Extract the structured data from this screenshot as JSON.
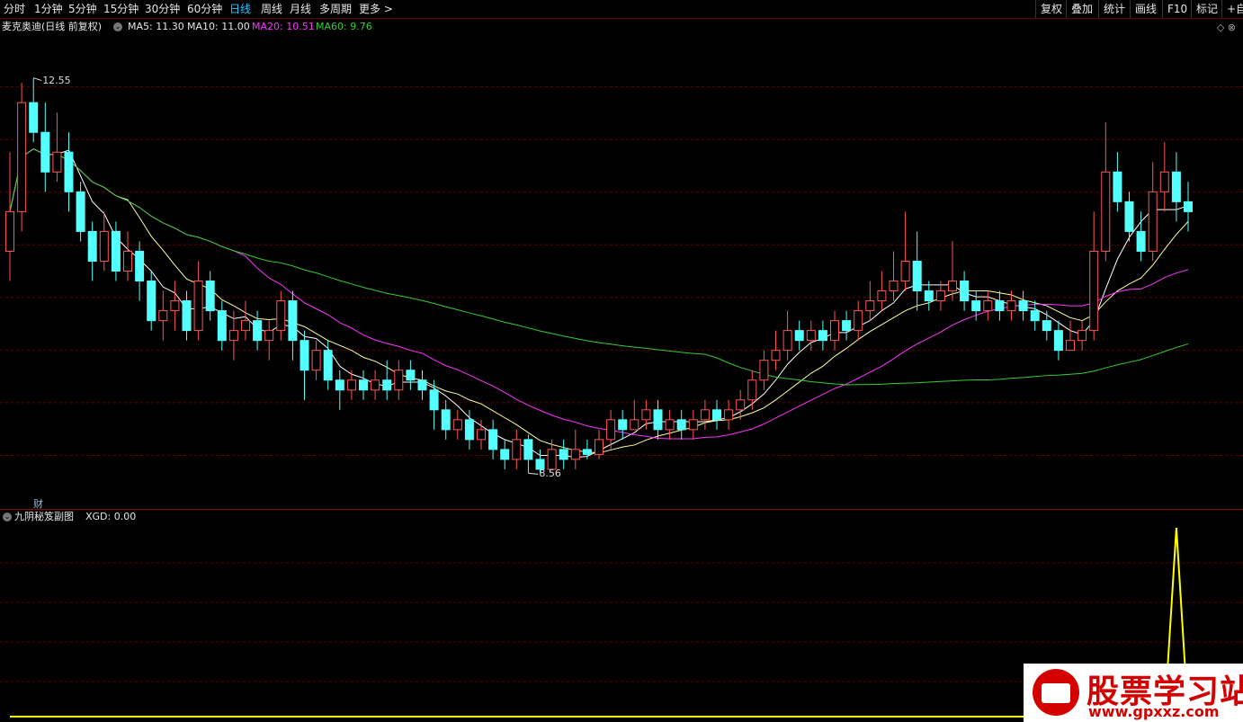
{
  "toolbar": {
    "periods": [
      "分时",
      "1分钟",
      "5分钟",
      "15分钟",
      "30分钟",
      "60分钟",
      "日线",
      "周线",
      "月线",
      "多周期",
      "更多 >"
    ],
    "active_index": 6,
    "right_buttons": [
      "复权",
      "叠加",
      "统计",
      "画线",
      "F10",
      "标记",
      "+自"
    ]
  },
  "legend": {
    "stock_label": "麦克奥迪(日线 前复权)",
    "ma5": "MA5: 11.30",
    "ma10": "MA10: 11.00",
    "ma20": "MA20: 10.51",
    "ma60": "MA60: 9.76"
  },
  "annotations": {
    "high_label": "12.55",
    "low_label": "8.56",
    "cai": "财"
  },
  "sub_indicator": {
    "name": "九阴秘笈副图",
    "xgd": "XGD: 0.00"
  },
  "watermark": {
    "title": "股票学习站",
    "url": "www.gpxxz.com"
  },
  "colors": {
    "up": "#ff5555",
    "down": "#54ffff",
    "ma5": "#ffffff",
    "ma10": "#ffff99",
    "ma20": "#ff33ff",
    "ma60": "#33cc33",
    "xgd": "#ffff00",
    "grid": "#5a0000"
  },
  "chart_data": {
    "type": "candlestick",
    "price_range": [
      8.3,
      12.9
    ],
    "candles": [
      [
        10.8,
        11.2,
        11.8,
        10.5
      ],
      [
        11.2,
        12.3,
        12.5,
        11.0
      ],
      [
        12.3,
        12.0,
        12.55,
        11.9
      ],
      [
        12.0,
        11.6,
        12.3,
        11.4
      ],
      [
        11.6,
        11.8,
        12.2,
        11.5
      ],
      [
        11.8,
        11.4,
        12.0,
        11.2
      ],
      [
        11.4,
        11.0,
        11.5,
        10.9
      ],
      [
        11.0,
        10.7,
        11.1,
        10.5
      ],
      [
        10.7,
        11.0,
        11.2,
        10.6
      ],
      [
        11.0,
        10.6,
        11.1,
        10.5
      ],
      [
        10.6,
        10.8,
        11.0,
        10.5
      ],
      [
        10.8,
        10.5,
        10.9,
        10.3
      ],
      [
        10.5,
        10.1,
        10.6,
        10.0
      ],
      [
        10.1,
        10.2,
        10.4,
        9.9
      ],
      [
        10.2,
        10.3,
        10.5,
        10.0
      ],
      [
        10.3,
        10.0,
        10.4,
        9.9
      ],
      [
        10.0,
        10.5,
        10.7,
        9.9
      ],
      [
        10.5,
        10.2,
        10.6,
        10.1
      ],
      [
        10.2,
        9.9,
        10.3,
        9.8
      ],
      [
        9.9,
        10.0,
        10.2,
        9.7
      ],
      [
        10.0,
        10.1,
        10.3,
        9.9
      ],
      [
        10.1,
        9.9,
        10.2,
        9.8
      ],
      [
        9.9,
        10.0,
        10.1,
        9.7
      ],
      [
        10.0,
        10.3,
        10.4,
        9.9
      ],
      [
        10.3,
        9.9,
        10.4,
        9.7
      ],
      [
        9.9,
        9.6,
        10.0,
        9.3
      ],
      [
        9.6,
        9.8,
        9.9,
        9.5
      ],
      [
        9.8,
        9.5,
        9.9,
        9.4
      ],
      [
        9.5,
        9.4,
        9.6,
        9.2
      ],
      [
        9.4,
        9.5,
        9.6,
        9.3
      ],
      [
        9.5,
        9.4,
        9.6,
        9.3
      ],
      [
        9.4,
        9.5,
        9.6,
        9.3
      ],
      [
        9.5,
        9.4,
        9.7,
        9.3
      ],
      [
        9.4,
        9.6,
        9.7,
        9.3
      ],
      [
        9.6,
        9.5,
        9.7,
        9.4
      ],
      [
        9.5,
        9.4,
        9.6,
        9.3
      ],
      [
        9.4,
        9.2,
        9.5,
        9.0
      ],
      [
        9.2,
        9.0,
        9.3,
        8.9
      ],
      [
        9.0,
        9.1,
        9.2,
        8.9
      ],
      [
        9.1,
        8.9,
        9.2,
        8.8
      ],
      [
        8.9,
        9.0,
        9.1,
        8.8
      ],
      [
        9.0,
        8.8,
        9.1,
        8.7
      ],
      [
        8.8,
        8.7,
        8.9,
        8.6
      ],
      [
        8.7,
        8.9,
        9.0,
        8.6
      ],
      [
        8.9,
        8.7,
        8.95,
        8.56
      ],
      [
        8.7,
        8.6,
        8.8,
        8.56
      ],
      [
        8.6,
        8.8,
        8.9,
        8.6
      ],
      [
        8.8,
        8.7,
        8.9,
        8.6
      ],
      [
        8.7,
        8.8,
        9.0,
        8.6
      ],
      [
        8.8,
        8.75,
        8.9,
        8.7
      ],
      [
        8.75,
        8.9,
        9.0,
        8.7
      ],
      [
        8.9,
        9.1,
        9.2,
        8.8
      ],
      [
        9.1,
        9.0,
        9.2,
        8.9
      ],
      [
        9.0,
        9.1,
        9.3,
        9.0
      ],
      [
        9.1,
        9.2,
        9.3,
        9.0
      ],
      [
        9.2,
        9.0,
        9.3,
        8.9
      ],
      [
        9.0,
        9.1,
        9.2,
        8.9
      ],
      [
        9.1,
        9.0,
        9.2,
        8.9
      ],
      [
        9.0,
        9.1,
        9.2,
        8.9
      ],
      [
        9.1,
        9.2,
        9.3,
        9.0
      ],
      [
        9.2,
        9.1,
        9.3,
        9.0
      ],
      [
        9.1,
        9.2,
        9.3,
        9.0
      ],
      [
        9.2,
        9.3,
        9.4,
        9.1
      ],
      [
        9.3,
        9.5,
        9.6,
        9.2
      ],
      [
        9.5,
        9.7,
        9.8,
        9.4
      ],
      [
        9.7,
        9.8,
        10.0,
        9.6
      ],
      [
        9.8,
        10.0,
        10.2,
        9.7
      ],
      [
        10.0,
        9.9,
        10.1,
        9.8
      ],
      [
        9.9,
        10.0,
        10.1,
        9.8
      ],
      [
        10.0,
        9.9,
        10.1,
        9.8
      ],
      [
        9.9,
        10.1,
        10.2,
        9.8
      ],
      [
        10.1,
        10.0,
        10.2,
        9.9
      ],
      [
        10.0,
        10.2,
        10.3,
        9.9
      ],
      [
        10.2,
        10.3,
        10.5,
        10.1
      ],
      [
        10.3,
        10.4,
        10.6,
        10.2
      ],
      [
        10.4,
        10.5,
        10.8,
        10.3
      ],
      [
        10.5,
        10.7,
        11.2,
        10.4
      ],
      [
        10.7,
        10.4,
        11.0,
        10.2
      ],
      [
        10.4,
        10.3,
        10.5,
        10.2
      ],
      [
        10.3,
        10.4,
        10.5,
        10.2
      ],
      [
        10.4,
        10.5,
        10.9,
        10.3
      ],
      [
        10.5,
        10.3,
        10.6,
        10.2
      ],
      [
        10.3,
        10.2,
        10.4,
        10.1
      ],
      [
        10.2,
        10.3,
        10.4,
        10.1
      ],
      [
        10.3,
        10.2,
        10.4,
        10.1
      ],
      [
        10.2,
        10.3,
        10.4,
        10.1
      ],
      [
        10.3,
        10.2,
        10.4,
        10.1
      ],
      [
        10.2,
        10.1,
        10.3,
        10.0
      ],
      [
        10.1,
        10.0,
        10.2,
        9.9
      ],
      [
        10.0,
        9.8,
        10.1,
        9.7
      ],
      [
        9.8,
        9.9,
        10.1,
        9.8
      ],
      [
        9.9,
        10.0,
        10.1,
        9.8
      ],
      [
        10.0,
        10.8,
        11.2,
        9.9
      ],
      [
        10.8,
        11.6,
        12.1,
        10.7
      ],
      [
        11.6,
        11.3,
        11.8,
        11.2
      ],
      [
        11.3,
        11.0,
        11.4,
        10.9
      ],
      [
        11.0,
        10.8,
        11.2,
        10.7
      ],
      [
        10.8,
        11.4,
        11.7,
        10.7
      ],
      [
        11.4,
        11.6,
        11.9,
        11.2
      ],
      [
        11.6,
        11.3,
        11.8,
        11.1
      ],
      [
        11.3,
        11.2,
        11.5,
        11.0
      ]
    ],
    "ma_lines": [
      "MA5",
      "MA10",
      "MA20",
      "MA60"
    ],
    "xgd_peak_index": 99
  }
}
